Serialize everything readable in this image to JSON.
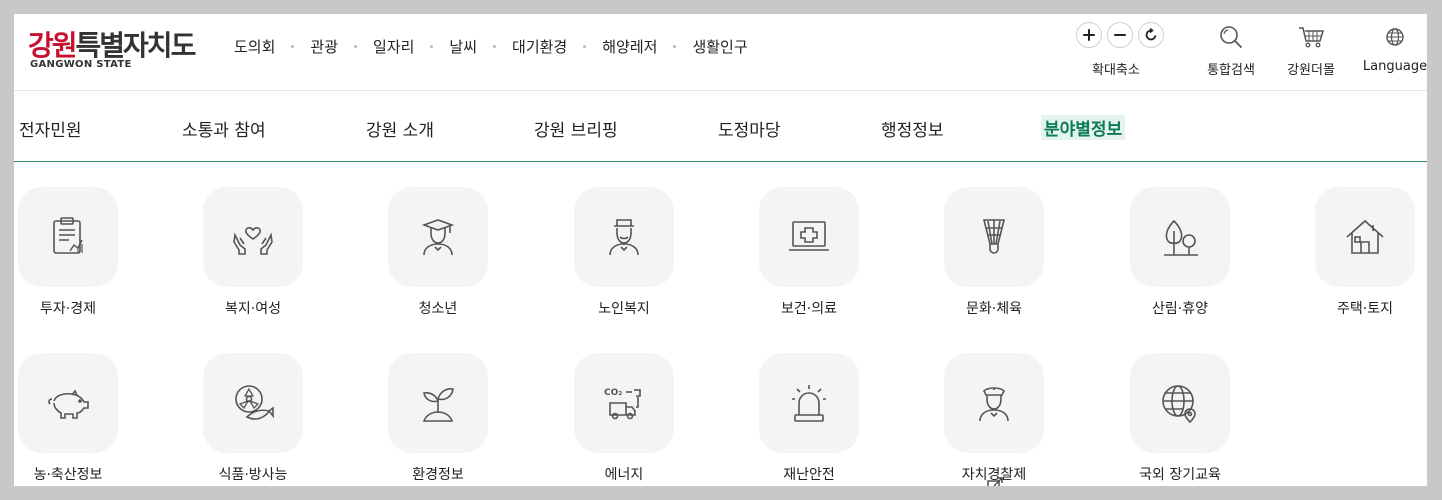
{
  "logo": {
    "name_red": "강원",
    "name_rest": "특별자치도",
    "sub": "GANGWON STATE"
  },
  "topnav": [
    "도의회",
    "관광",
    "일자리",
    "날씨",
    "대기환경",
    "해양레저",
    "생활인구"
  ],
  "tools": {
    "zoom_label": "확대축소",
    "search_label": "통합검색",
    "cart_label": "강원더몰",
    "lang_label": "Language"
  },
  "mainnav": [
    "전자민원",
    "소통과 참여",
    "강원 소개",
    "강원 브리핑",
    "도정마당",
    "행정정보",
    "분야별정보"
  ],
  "active_tab": "분야별정보",
  "categories": [
    {
      "label": "투자·경제",
      "icon": "economy-report-icon"
    },
    {
      "label": "복지·여성",
      "icon": "welfare-hands-heart-icon"
    },
    {
      "label": "청소년",
      "icon": "graduate-icon"
    },
    {
      "label": "노인복지",
      "icon": "elderly-icon"
    },
    {
      "label": "보건·의료",
      "icon": "medical-monitor-icon"
    },
    {
      "label": "문화·체육",
      "icon": "shuttlecock-icon"
    },
    {
      "label": "산림·휴양",
      "icon": "trees-icon"
    },
    {
      "label": "주택·토지",
      "icon": "house-icon"
    },
    {
      "label": "농·축산정보",
      "icon": "pig-icon"
    },
    {
      "label": "식품·방사능",
      "icon": "radiation-fish-icon"
    },
    {
      "label": "환경정보",
      "icon": "sprout-icon"
    },
    {
      "label": "에너지",
      "icon": "co2-truck-icon"
    },
    {
      "label": "재난안전",
      "icon": "siren-icon"
    },
    {
      "label": "자치경찰제",
      "icon": "police-officer-icon"
    },
    {
      "label": "국외 장기교육",
      "icon": "globe-location-icon"
    }
  ],
  "colors": {
    "brand_red": "#c8102e",
    "active_green": "#0a7a5a"
  }
}
